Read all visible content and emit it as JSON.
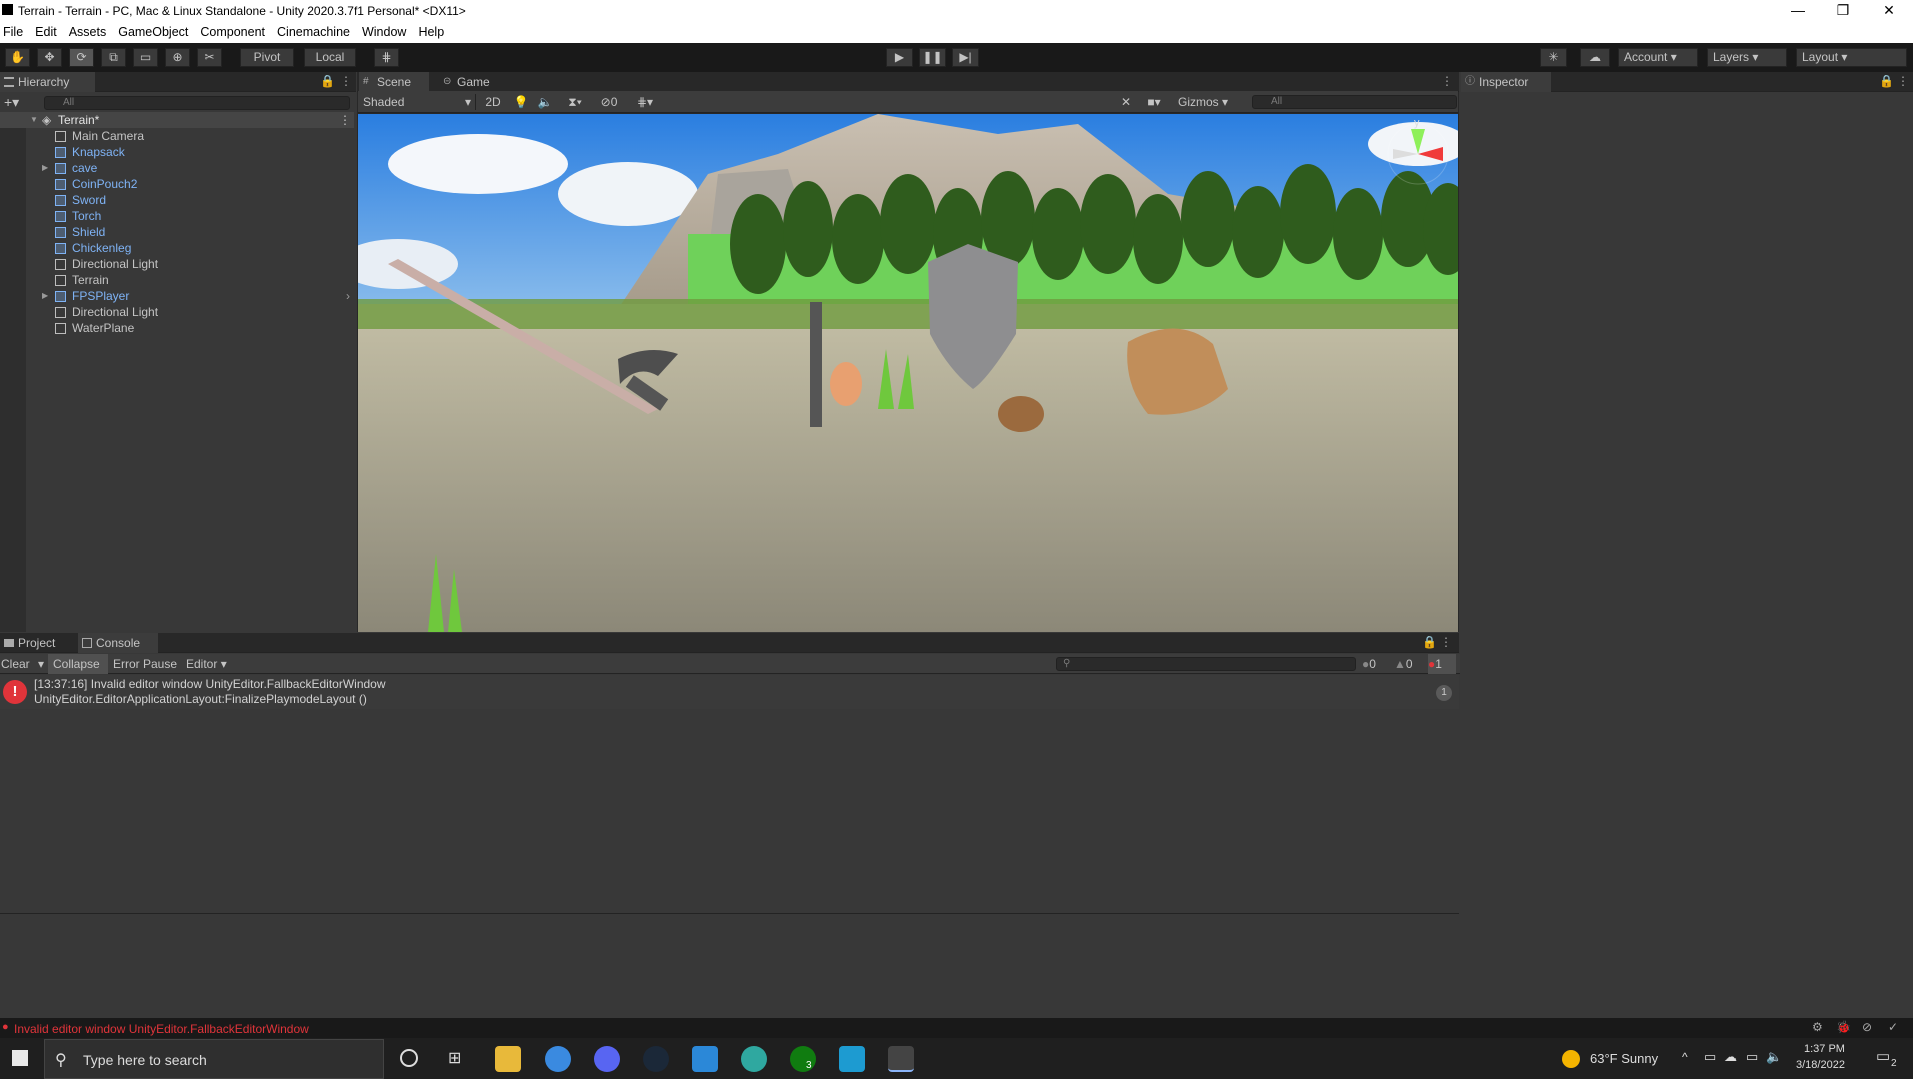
{
  "window": {
    "title": "Terrain - Terrain - PC, Mac & Linux Standalone - Unity 2020.3.7f1 Personal* <DX11>",
    "controls": [
      "—",
      "❐",
      "✕"
    ]
  },
  "menu": [
    "File",
    "Edit",
    "Assets",
    "GameObject",
    "Component",
    "Cinemachine",
    "Window",
    "Help"
  ],
  "toolbar": {
    "pivot": "Pivot",
    "local": "Local",
    "account": "Account",
    "layers": "Layers",
    "layout": "Layout"
  },
  "hierarchy": {
    "tab": "Hierarchy",
    "search_placeholder": "All",
    "scene": "Terrain*",
    "items": [
      {
        "label": "Main Camera",
        "prefab": false,
        "expandable": false
      },
      {
        "label": "Knapsack",
        "prefab": true,
        "expandable": false
      },
      {
        "label": "cave",
        "prefab": true,
        "expandable": true
      },
      {
        "label": "CoinPouch2",
        "prefab": true,
        "expandable": false
      },
      {
        "label": "Sword",
        "prefab": true,
        "expandable": false
      },
      {
        "label": "Torch",
        "prefab": true,
        "expandable": false
      },
      {
        "label": "Shield",
        "prefab": true,
        "expandable": false
      },
      {
        "label": "Chickenleg",
        "prefab": true,
        "expandable": false
      },
      {
        "label": "Directional Light",
        "prefab": false,
        "expandable": false
      },
      {
        "label": "Terrain",
        "prefab": false,
        "expandable": false
      },
      {
        "label": "FPSPlayer",
        "prefab": true,
        "expandable": true
      },
      {
        "label": "Directional Light",
        "prefab": false,
        "expandable": false
      },
      {
        "label": "WaterPlane",
        "prefab": false,
        "expandable": false
      }
    ]
  },
  "scene": {
    "tabs": [
      "Scene",
      "Game"
    ],
    "shading": "Shaded",
    "mode2d": "2D",
    "hidden_count": "0",
    "gizmos": "Gizmos",
    "search_placeholder": "All",
    "axis_label": "y"
  },
  "inspector": {
    "tab": "Inspector"
  },
  "console": {
    "tabs": [
      "Project",
      "Console"
    ],
    "clear": "Clear",
    "collapse": "Collapse",
    "error_pause": "Error Pause",
    "editor": "Editor",
    "log_count": "0",
    "warn_count": "0",
    "error_count": "1",
    "entry_line1": "[13:37:16] Invalid editor window UnityEditor.FallbackEditorWindow",
    "entry_line2": "UnityEditor.EditorApplicationLayout:FinalizePlaymodeLayout ()",
    "entry_count": "1"
  },
  "status": {
    "message": "Invalid editor window UnityEditor.FallbackEditorWindow"
  },
  "taskbar": {
    "search_placeholder": "Type here to search",
    "weather": "63°F  Sunny",
    "time": "1:37 PM",
    "date": "3/18/2022",
    "xbox_badge": "3",
    "notif_count": "2"
  }
}
